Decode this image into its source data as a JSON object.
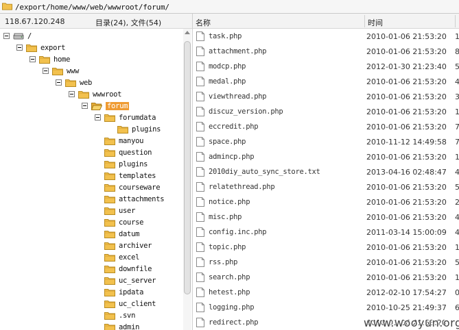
{
  "path_bar": {
    "path": "/export/home/www/web/wwwroot/forum/"
  },
  "left_header": {
    "host": "118.67.120.248",
    "counts": "目录(24), 文件(54)"
  },
  "list_header": {
    "name_col": "名称",
    "time_col": "时间"
  },
  "tree": [
    {
      "label": "/",
      "indent": 0,
      "toggle": true,
      "icon": "drive-icon"
    },
    {
      "label": "export",
      "indent": 1,
      "toggle": true,
      "icon": "folder-icon"
    },
    {
      "label": "home",
      "indent": 2,
      "toggle": true,
      "icon": "folder-icon"
    },
    {
      "label": "www",
      "indent": 3,
      "toggle": true,
      "icon": "folder-icon"
    },
    {
      "label": "web",
      "indent": 4,
      "toggle": true,
      "icon": "folder-icon"
    },
    {
      "label": "wwwroot",
      "indent": 5,
      "toggle": true,
      "icon": "folder-icon"
    },
    {
      "label": "forum",
      "indent": 6,
      "toggle": true,
      "icon": "folder-open-icon",
      "selected": true
    },
    {
      "label": "forumdata",
      "indent": 7,
      "toggle": true,
      "icon": "folder-icon"
    },
    {
      "label": "plugins",
      "indent": 8,
      "toggle": false,
      "icon": "folder-icon"
    },
    {
      "label": "manyou",
      "indent": 7,
      "toggle": false,
      "icon": "folder-icon"
    },
    {
      "label": "question",
      "indent": 7,
      "toggle": false,
      "icon": "folder-icon"
    },
    {
      "label": "plugins",
      "indent": 7,
      "toggle": false,
      "icon": "folder-icon"
    },
    {
      "label": "templates",
      "indent": 7,
      "toggle": false,
      "icon": "folder-icon"
    },
    {
      "label": "courseware",
      "indent": 7,
      "toggle": false,
      "icon": "folder-icon"
    },
    {
      "label": "attachments",
      "indent": 7,
      "toggle": false,
      "icon": "folder-icon"
    },
    {
      "label": "user",
      "indent": 7,
      "toggle": false,
      "icon": "folder-icon"
    },
    {
      "label": "course",
      "indent": 7,
      "toggle": false,
      "icon": "folder-icon"
    },
    {
      "label": "datum",
      "indent": 7,
      "toggle": false,
      "icon": "folder-icon"
    },
    {
      "label": "archiver",
      "indent": 7,
      "toggle": false,
      "icon": "folder-icon"
    },
    {
      "label": "excel",
      "indent": 7,
      "toggle": false,
      "icon": "folder-icon"
    },
    {
      "label": "downfile",
      "indent": 7,
      "toggle": false,
      "icon": "folder-icon"
    },
    {
      "label": "uc_server",
      "indent": 7,
      "toggle": false,
      "icon": "folder-icon"
    },
    {
      "label": "ipdata",
      "indent": 7,
      "toggle": false,
      "icon": "folder-icon"
    },
    {
      "label": "uc_client",
      "indent": 7,
      "toggle": false,
      "icon": "folder-icon"
    },
    {
      "label": ".svn",
      "indent": 7,
      "toggle": false,
      "icon": "folder-icon"
    },
    {
      "label": "admin",
      "indent": 7,
      "toggle": false,
      "icon": "folder-icon"
    }
  ],
  "files": [
    {
      "name": "task.php",
      "time": "2010-01-06 21:53:20",
      "size": "1"
    },
    {
      "name": "attachment.php",
      "time": "2010-01-06 21:53:20",
      "size": "8"
    },
    {
      "name": "modcp.php",
      "time": "2012-01-30 21:23:40",
      "size": "5"
    },
    {
      "name": "medal.php",
      "time": "2010-01-06 21:53:20",
      "size": "4"
    },
    {
      "name": "viewthread.php",
      "time": "2010-01-06 21:53:20",
      "size": "3"
    },
    {
      "name": "discuz_version.php",
      "time": "2010-01-06 21:53:20",
      "size": "1"
    },
    {
      "name": "eccredit.php",
      "time": "2010-01-06 21:53:20",
      "size": "7"
    },
    {
      "name": "space.php",
      "time": "2010-11-12 14:49:58",
      "size": "7"
    },
    {
      "name": "admincp.php",
      "time": "2010-01-06 21:53:20",
      "size": "1"
    },
    {
      "name": "2010diy_auto_sync_store.txt",
      "time": "2013-04-16 02:48:47",
      "size": "4"
    },
    {
      "name": "relatethread.php",
      "time": "2010-01-06 21:53:20",
      "size": "5"
    },
    {
      "name": "notice.php",
      "time": "2010-01-06 21:53:20",
      "size": "2"
    },
    {
      "name": "misc.php",
      "time": "2010-01-06 21:53:20",
      "size": "4"
    },
    {
      "name": "config.inc.php",
      "time": "2011-03-14 15:00:09",
      "size": "4"
    },
    {
      "name": "topic.php",
      "time": "2010-01-06 21:53:20",
      "size": "1"
    },
    {
      "name": "rss.php",
      "time": "2010-01-06 21:53:20",
      "size": "5"
    },
    {
      "name": "search.php",
      "time": "2010-01-06 21:53:20",
      "size": "1"
    },
    {
      "name": "hetest.php",
      "time": "2012-02-10 17:54:27",
      "size": "0"
    },
    {
      "name": "logging.php",
      "time": "2010-10-25 21:49:37",
      "size": "6"
    },
    {
      "name": "redirect.php",
      "time": "2010-01-06 21:53:20",
      "size": ""
    }
  ],
  "watermark": "www.wooyun.org",
  "colors": {
    "selection": "#ef9b32",
    "folder": "#f2c14e"
  }
}
